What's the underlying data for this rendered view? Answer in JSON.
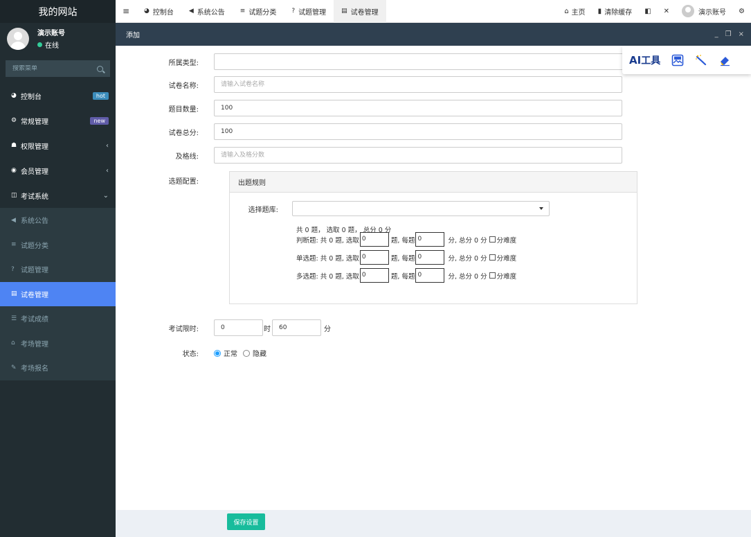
{
  "sidebar": {
    "logo": "我的网站",
    "user_name": "演示账号",
    "user_status": "在线",
    "search_placeholder": "搜索菜单",
    "items": [
      {
        "label": "控制台",
        "badge": "hot"
      },
      {
        "label": "常规管理",
        "badge": "new"
      },
      {
        "label": "权限管理",
        "arrow": "‹"
      },
      {
        "label": "会员管理",
        "arrow": "‹"
      },
      {
        "label": "考试系统",
        "arrow": "⌄"
      }
    ],
    "subitems": [
      {
        "label": "系统公告"
      },
      {
        "label": "试题分类"
      },
      {
        "label": "试题管理"
      },
      {
        "label": "试卷管理"
      },
      {
        "label": "考试成绩"
      },
      {
        "label": "考场管理"
      },
      {
        "label": "考场报名"
      }
    ]
  },
  "topnav": {
    "tabs": [
      {
        "label": "控制台"
      },
      {
        "label": "系统公告"
      },
      {
        "label": "试题分类"
      },
      {
        "label": "试题管理"
      },
      {
        "label": "试卷管理"
      }
    ],
    "home": "主页",
    "clear_cache": "清除缓存",
    "account": "演示账号"
  },
  "dialog": {
    "title": "添加"
  },
  "form": {
    "type_label": "所属类型:",
    "name_label": "试卷名称:",
    "name_placeholder": "请输入试卷名称",
    "count_label": "题目数量:",
    "count_value": "100",
    "total_label": "试卷总分:",
    "total_value": "100",
    "pass_label": "及格线:",
    "pass_placeholder": "请输入及格分数",
    "config_label": "选题配置:",
    "rule_title": "出题规则",
    "bank_label": "选择题库:",
    "summary": "共 0 题， 选取 0 题， 总分 0 分",
    "questions": [
      {
        "type": "判断题:",
        "total": "共 0 题,",
        "pick": "选取",
        "pick_value": "0",
        "ti": "题,",
        "each": "每题",
        "each_value": "0",
        "fen": "分,",
        "sum": "总分 0 分",
        "difficulty": "分难度"
      },
      {
        "type": "单选题:",
        "total": "共 0 题,",
        "pick": "选取",
        "pick_value": "0",
        "ti": "题,",
        "each": "每题",
        "each_value": "0",
        "fen": "分,",
        "sum": "总分 0 分",
        "difficulty": "分难度"
      },
      {
        "type": "多选题:",
        "total": "共 0 题,",
        "pick": "选取",
        "pick_value": "0",
        "ti": "题,",
        "each": "每题",
        "each_value": "0",
        "fen": "分,",
        "sum": "总分 0 分",
        "difficulty": "分难度"
      }
    ],
    "limit_label": "考试限时:",
    "limit_hours": "0",
    "hour_unit": "时",
    "limit_minutes": "60",
    "minute_unit": "分",
    "status_label": "状态:",
    "status_normal": "正常",
    "status_hidden": "隐藏"
  },
  "footer": {
    "save": "保存设置"
  },
  "ai_toolbar": {
    "ai": "AI",
    "tool": "工具"
  },
  "colors": {
    "sidebar_bg": "#222d32",
    "active_item": "#4e84f3",
    "dialog_header": "#2f4050",
    "save_button": "#18bc9c"
  }
}
